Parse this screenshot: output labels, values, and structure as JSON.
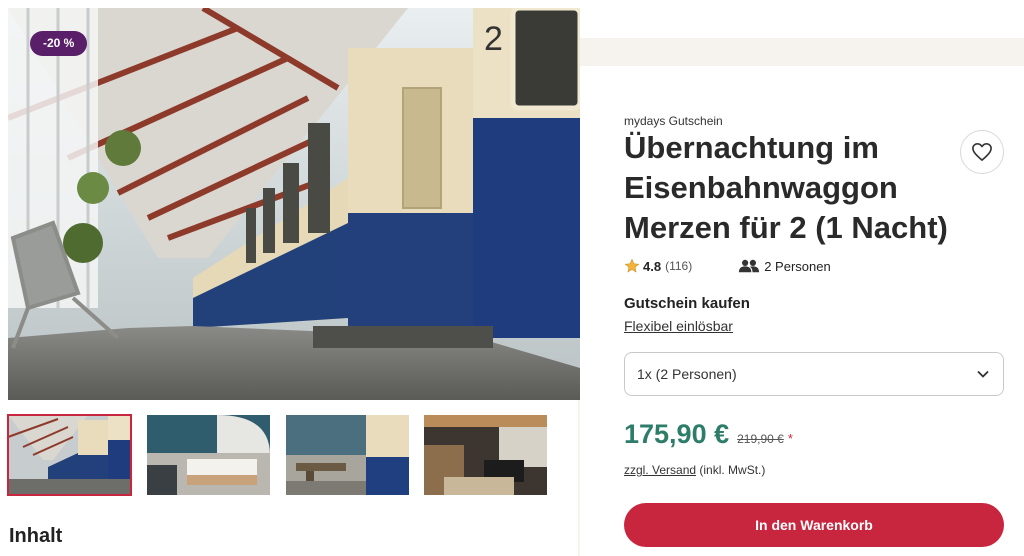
{
  "hero": {
    "discount_badge": "-20 %"
  },
  "content": {
    "section_heading": "Inhalt"
  },
  "product": {
    "brand": "mydays Gutschein",
    "title": "Übernachtung im Eisenbahnwaggon Merzen für 2 (1 Nacht)",
    "rating": "4.8",
    "review_count": "(116)",
    "persons": "2 Personen",
    "buy_label": "Gutschein kaufen",
    "redeem_link": "Flexibel einlösbar",
    "option_selected": "1x (2 Personen)",
    "price": "175,90 €",
    "old_price": "219,90 €",
    "price_note_marker": "*",
    "shipping_link": "zzgl. Versand",
    "shipping_note": "(inkl. MwSt.)",
    "cart_button": "In den Warenkorb"
  },
  "icons": {
    "wishlist": "heart-icon",
    "rating": "star-icon",
    "persons": "people-icon",
    "select": "chevron-down-icon"
  },
  "colors": {
    "accent_red": "#c8263f",
    "price_green": "#2e7d6b",
    "badge_purple": "#5a1f69"
  }
}
